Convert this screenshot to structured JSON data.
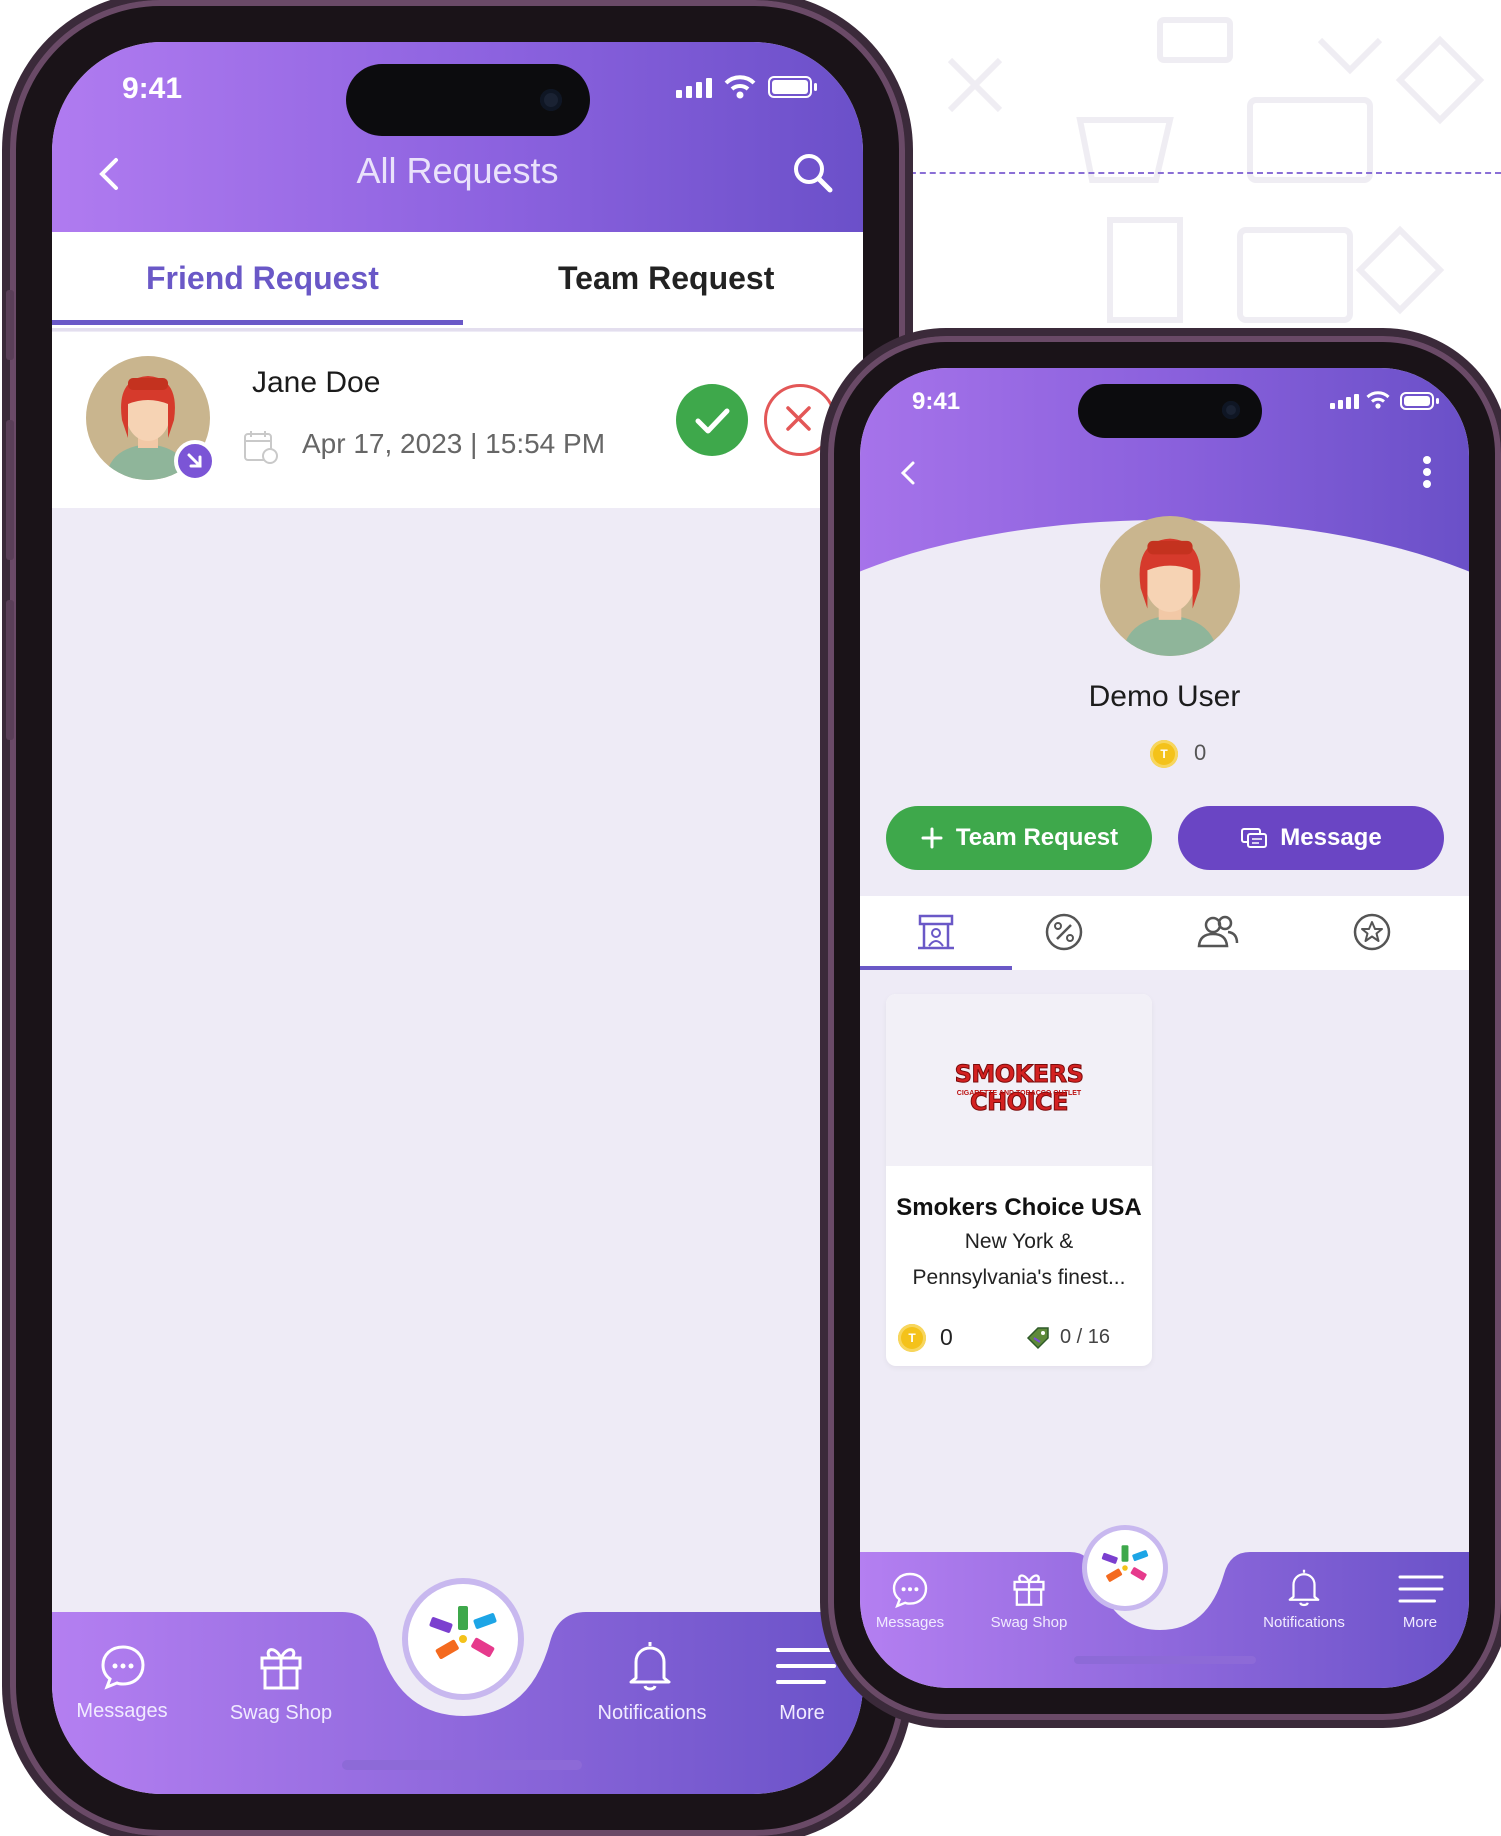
{
  "colors": {
    "accent": "#6a58c7",
    "header_start": "#b07bf0",
    "header_end": "#6b50c9",
    "accept": "#3ea84b",
    "reject": "#e35757",
    "message_button": "#6a45c4"
  },
  "phone1": {
    "status_time": "9:41",
    "header": {
      "title": "All Requests"
    },
    "tabs": [
      {
        "label": "Friend Request",
        "active": true
      },
      {
        "label": "Team Request",
        "active": false
      }
    ],
    "request": {
      "name": "Jane Doe",
      "date": "Apr 17, 2023 | 15:54 PM"
    },
    "nav": [
      {
        "label": "Messages",
        "icon": "chat-bubble-icon"
      },
      {
        "label": "Swag Shop",
        "icon": "gift-icon"
      },
      {
        "label": "Notifications",
        "icon": "bell-icon"
      },
      {
        "label": "More",
        "icon": "menu-icon"
      }
    ]
  },
  "phone2": {
    "status_time": "9:41",
    "profile": {
      "name": "Demo User",
      "coins": "0"
    },
    "buttons": {
      "team_request": "Team Request",
      "message": "Message"
    },
    "tabs": [
      {
        "icon": "store-icon",
        "active": true
      },
      {
        "icon": "discount-icon",
        "active": false
      },
      {
        "icon": "users-icon",
        "active": false
      },
      {
        "icon": "star-badge-icon",
        "active": false
      }
    ],
    "store_card": {
      "logo_text": "SMOKERS CHOICE",
      "logo_subtext": "CIGARETTE AND TOBACCO OUTLET",
      "title": "Smokers Choice USA",
      "desc_line1": "New York &",
      "desc_line2": "Pennsylvania's finest...",
      "coins": "0",
      "deals": "0 / 16"
    },
    "nav": [
      {
        "label": "Messages",
        "icon": "chat-bubble-icon"
      },
      {
        "label": "Swag Shop",
        "icon": "gift-icon"
      },
      {
        "label": "Notifications",
        "icon": "bell-icon"
      },
      {
        "label": "More",
        "icon": "menu-icon"
      }
    ]
  }
}
